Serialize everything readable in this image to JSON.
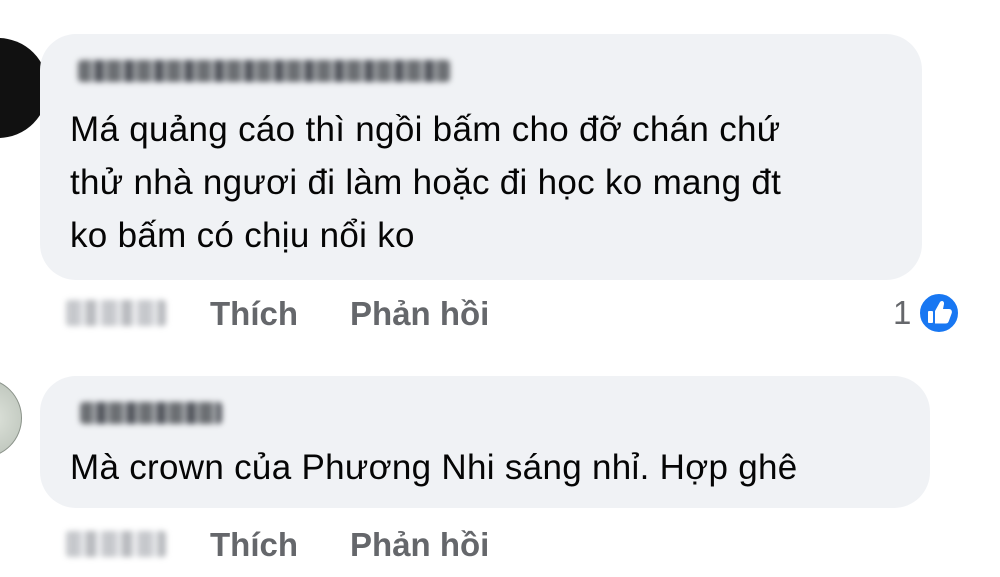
{
  "comments": [
    {
      "text_lines": [
        "Má quảng cáo thì ngồi bấm cho đỡ chán chứ",
        "thử nhà ngươi đi làm hoặc đi học ko mang đt",
        "ko bấm có chịu nổi ko"
      ],
      "actions": {
        "like": "Thích",
        "reply": "Phản hồi"
      },
      "reaction_count": "1",
      "reaction_icon": "thumbs-up-icon",
      "reaction_color": "#1877f2"
    },
    {
      "text_lines": [
        "Mà crown của Phương Nhi sáng nhỉ. Hợp ghê"
      ],
      "actions": {
        "like": "Thích",
        "reply": "Phản hồi"
      }
    }
  ],
  "colors": {
    "bubble_background": "#f0f2f5",
    "text": "#050505",
    "secondary_text": "#65676b"
  }
}
